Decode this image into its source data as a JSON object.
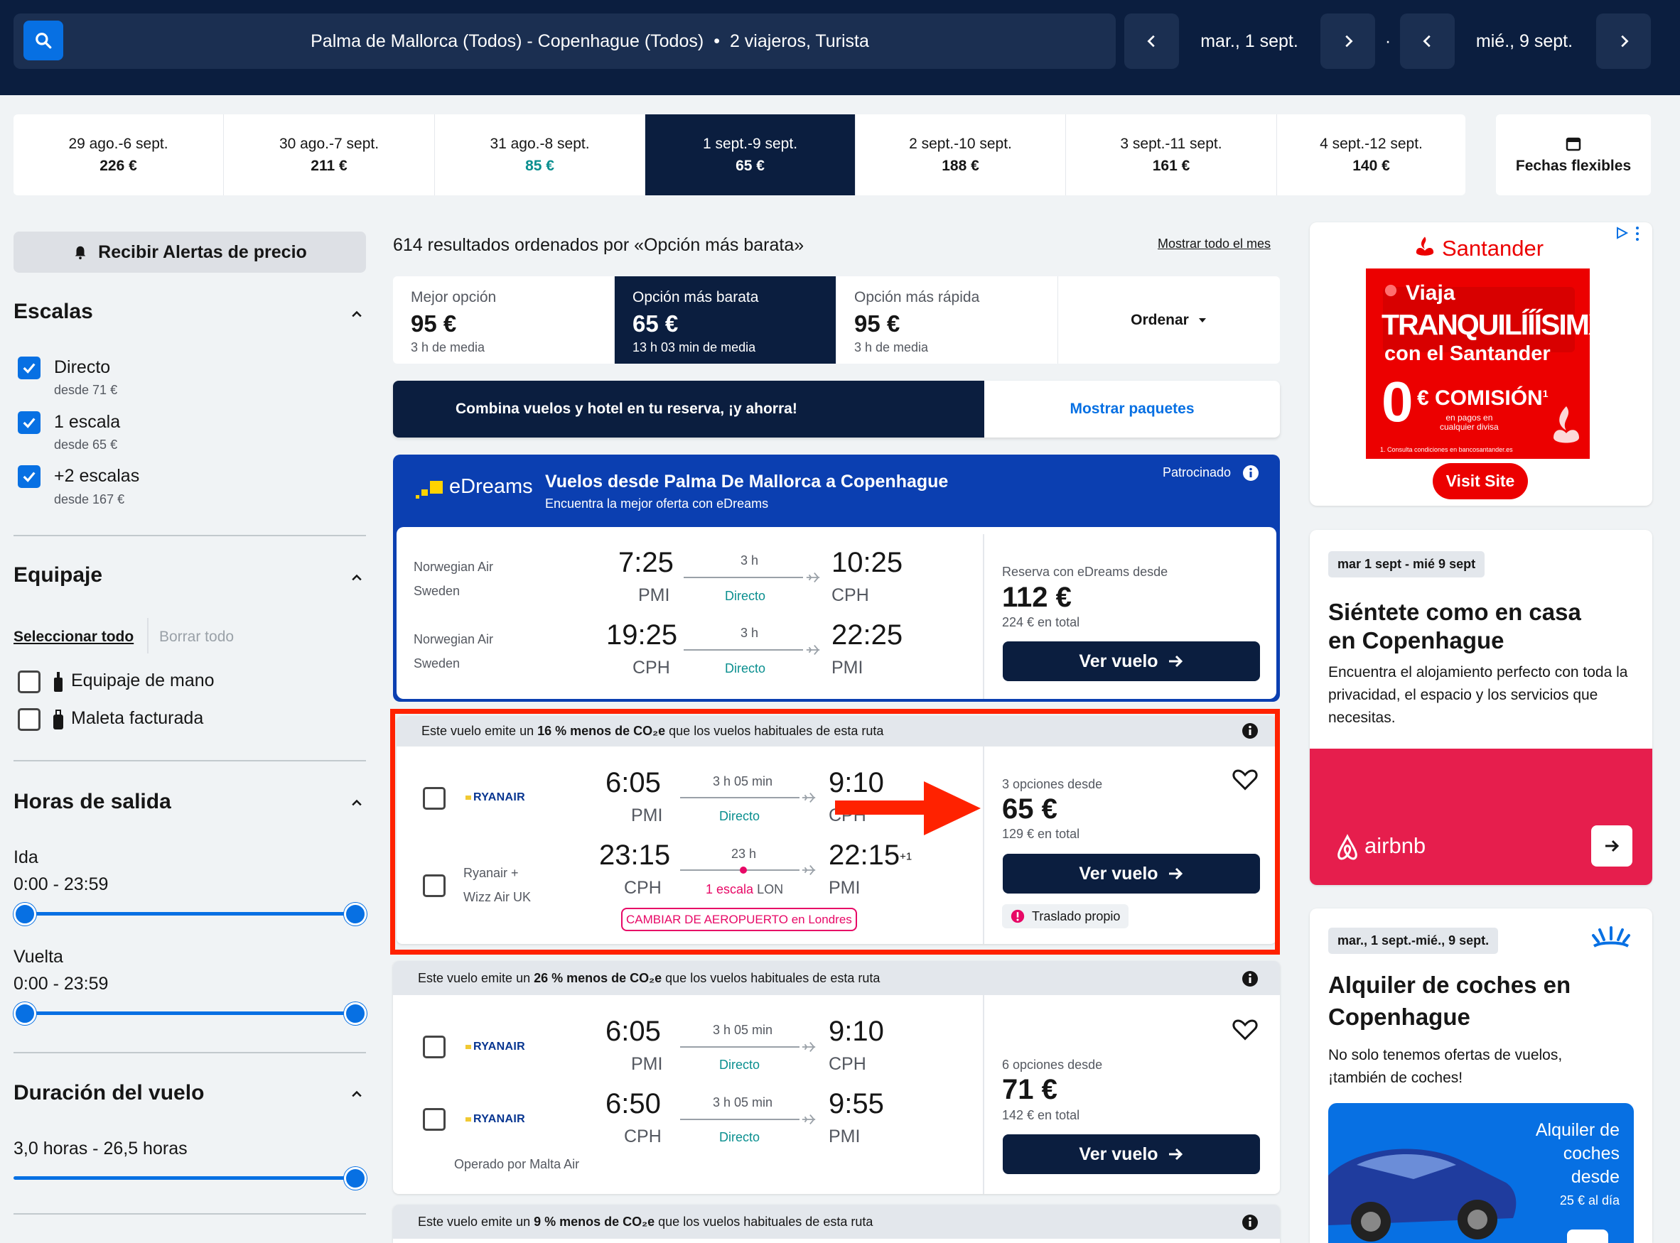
{
  "header": {
    "route": "Palma de Mallorca (Todos) - Copenhague (Todos)",
    "separator": "•",
    "travellers": "2 viajeros, Turista",
    "depart_date": "mar., 1 sept.",
    "date_separator": "·",
    "return_date": "mié., 9 sept."
  },
  "date_strip": [
    {
      "range": "29 ago.-6 sept.",
      "price": "226 €"
    },
    {
      "range": "30 ago.-7 sept.",
      "price": "211 €"
    },
    {
      "range": "31 ago.-8 sept.",
      "price": "85 €"
    },
    {
      "range": "1 sept.-9 sept.",
      "price": "65 €"
    },
    {
      "range": "2 sept.-10 sept.",
      "price": "188 €"
    },
    {
      "range": "3 sept.-11 sept.",
      "price": "161 €"
    },
    {
      "range": "4 sept.-12 sept.",
      "price": "140 €"
    }
  ],
  "flexible_dates": "Fechas flexibles",
  "sidebar": {
    "alert_button": "Recibir Alertas de precio",
    "stops": {
      "title": "Escalas",
      "items": [
        {
          "label": "Directo",
          "sub": "desde 71 €"
        },
        {
          "label": "1 escala",
          "sub": "desde 65 €"
        },
        {
          "label": "+2 escalas",
          "sub": "desde 167 €"
        }
      ]
    },
    "baggage": {
      "title": "Equipaje",
      "select_all": "Seleccionar todo",
      "clear_all": "Borrar todo",
      "items": [
        "Equipaje de mano",
        "Maleta facturada"
      ]
    },
    "times": {
      "title": "Horas de salida",
      "outbound_label": "Ida",
      "outbound_range": "0:00 - 23:59",
      "return_label": "Vuelta",
      "return_range": "0:00 - 23:59"
    },
    "duration": {
      "title": "Duración del vuelo",
      "range": "3,0 horas - 26,5 horas"
    }
  },
  "results": {
    "count_text": "614 resultados ordenados por «Opción más barata»",
    "show_month": "Mostrar todo el mes",
    "sort_tabs": [
      {
        "label": "Mejor opción",
        "price": "95 €",
        "sub": "3 h de media"
      },
      {
        "label": "Opción más barata",
        "price": "65 €",
        "sub": "13 h 03 min de media"
      },
      {
        "label": "Opción más rápida",
        "price": "95 €",
        "sub": "3 h de media"
      }
    ],
    "sort_button": "Ordenar",
    "combo_text": "Combina vuelos y hotel en tu reserva, ¡y ahorra!",
    "combo_link": "Mostrar paquetes"
  },
  "sponsored": {
    "brand": "eDreams",
    "title": "Vuelos desde Palma De Mallorca a Copenhague",
    "subtitle": "Encuentra la mejor oferta con eDreams",
    "badge": "Patrocinado",
    "legs": [
      {
        "airline": [
          "Norwegian Air",
          "Sweden"
        ],
        "dep": "7:25",
        "dep_code": "PMI",
        "dur": "3 h",
        "stops": "Directo",
        "arr": "10:25",
        "arr_code": "CPH"
      },
      {
        "airline": [
          "Norwegian Air",
          "Sweden"
        ],
        "dep": "19:25",
        "dep_code": "CPH",
        "dur": "3 h",
        "stops": "Directo",
        "arr": "22:25",
        "arr_code": "PMI"
      }
    ],
    "price_label": "Reserva con eDreams desde",
    "price": "112 €",
    "total": "224 € en total",
    "button": "Ver vuelo"
  },
  "card1": {
    "co2_pre": "Este vuelo emite un ",
    "co2_bold": "16 % menos de CO₂e",
    "co2_post": " que los vuelos habituales de esta ruta",
    "legs": [
      {
        "airline": "RYANAIR",
        "dep": "6:05",
        "dep_code": "PMI",
        "dur": "3 h 05 min",
        "stops": "Directo",
        "arr": "9:10",
        "arr_code": "CPH"
      },
      {
        "airline": [
          "Ryanair +",
          "Wizz Air UK"
        ],
        "dep": "23:15",
        "dep_code": "CPH",
        "dur": "23 h",
        "stops": "1 escala",
        "stop_code": "LON",
        "arr": "22:15",
        "arr_sup": "+1",
        "arr_code": "PMI",
        "warning": "CAMBIAR DE AEROPUERTO en Londres"
      }
    ],
    "price_label": "3 opciones desde",
    "price": "65 €",
    "total": "129 € en total",
    "button": "Ver vuelo",
    "transfer": "Traslado propio"
  },
  "card2": {
    "co2_pre": "Este vuelo emite un ",
    "co2_bold": "26 % menos de CO₂e",
    "co2_post": " que los vuelos habituales de esta ruta",
    "legs": [
      {
        "airline": "RYANAIR",
        "dep": "6:05",
        "dep_code": "PMI",
        "dur": "3 h 05 min",
        "stops": "Directo",
        "arr": "9:10",
        "arr_code": "CPH"
      },
      {
        "airline": "RYANAIR",
        "dep": "6:50",
        "dep_code": "CPH",
        "dur": "3 h 05 min",
        "stops": "Directo",
        "arr": "9:55",
        "arr_code": "PMI"
      }
    ],
    "operated": "Operado por Malta Air",
    "price_label": "6 opciones desde",
    "price": "71 €",
    "total": "142 € en total",
    "button": "Ver vuelo"
  },
  "card3": {
    "co2_pre": "Este vuelo emite un ",
    "co2_bold": "9 % menos de CO₂e",
    "co2_post": " que los vuelos habituales de esta ruta"
  },
  "ads": {
    "santander": {
      "brand": "Santander",
      "line1": "Viaja",
      "line2": "TRANQUILÍÍÍSIMX",
      "line3": "con el Santander",
      "zero": "0",
      "commission": "€ COMISIÓN",
      "commission_sup": "1",
      "small1": "en pagos en",
      "small2": "cualquier divisa",
      "fine": "1. Consulta condiciones en bancosantander.es",
      "cta": "Visit Site"
    },
    "airbnb": {
      "dates": "mar 1 sept - mié 9 sept",
      "title": "Siéntete como en casa en Copenhague",
      "text": "Encuentra el alojamiento perfecto con toda la privacidad, el espacio y los servicios que necesitas.",
      "brand": "airbnb"
    },
    "cars": {
      "dates": "mar., 1 sept.-mié., 9 sept.",
      "title": "Alquiler de coches en Copenhague",
      "text": "No solo tenemos ofertas de vuelos, ¡también de coches!",
      "promo1": "Alquiler de",
      "promo2": "coches",
      "promo3": "desde",
      "promo4": "25 € al día"
    }
  },
  "colors": {
    "navy": "#0b1e3f",
    "blue": "#0770e3",
    "teal": "#0a8f8f",
    "highlight": "#ff2200",
    "santander": "#ec0000",
    "airbnb": "#e61e4d",
    "edreams": "#0b3fb1"
  }
}
